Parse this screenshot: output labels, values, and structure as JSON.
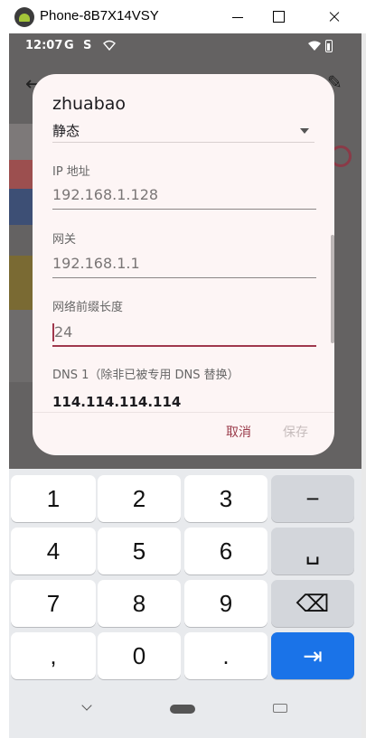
{
  "window": {
    "title": "Phone-8B7X14VSY"
  },
  "status_bar": {
    "time": "12:07",
    "icons": [
      "google-g-icon",
      "s-app-icon",
      "wifi-off-icon",
      "wifi-icon",
      "battery-icon"
    ]
  },
  "dialog": {
    "title": "zhuabao",
    "ip_mode": "静态",
    "ip_label": "IP 地址",
    "ip_value": "192.168.1.128",
    "gateway_label": "网关",
    "gateway_value": "192.168.1.1",
    "prefix_label": "网络前缀长度",
    "prefix_value": "24",
    "dns1_label": "DNS 1（除非已被专用 DNS 替换）",
    "dns1_value": "114.114.114.114",
    "cancel_label": "取消",
    "save_label": "保存"
  },
  "keyboard": {
    "keys": [
      "1",
      "2",
      "3",
      "−",
      "4",
      "5",
      "6",
      "␣",
      "7",
      "8",
      "9",
      "⌫",
      ",",
      "0",
      ".",
      "⇥"
    ],
    "accent": "#1a73e8"
  },
  "colors": {
    "accent": "#a0384d",
    "dialog_bg": "#fdf5f5",
    "scrim": "#646262"
  }
}
